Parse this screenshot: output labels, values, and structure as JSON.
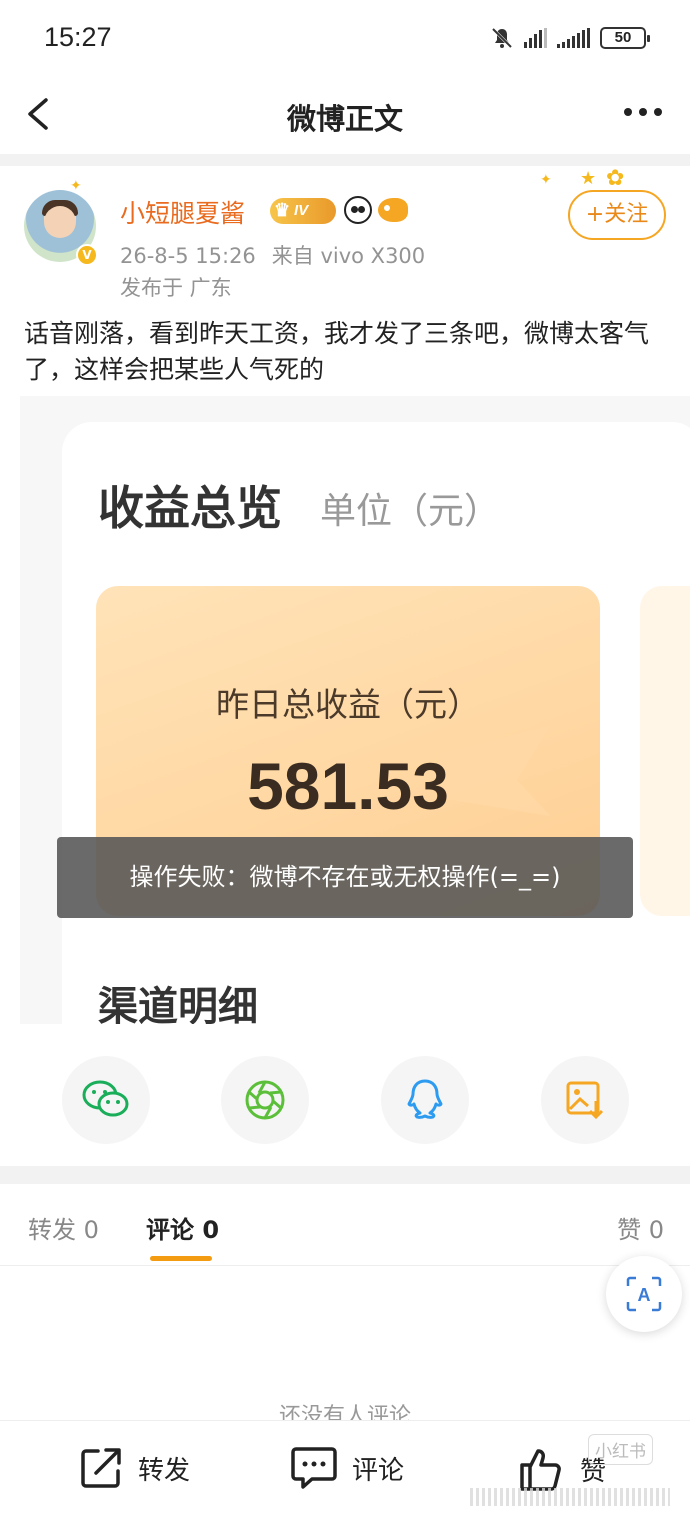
{
  "status_bar": {
    "time": "15:27",
    "battery": "50",
    "icons": [
      "mute-bell-icon",
      "signal-icon",
      "signal-icon",
      "battery-icon"
    ]
  },
  "nav": {
    "title": "微博正文",
    "back_icon": "chevron-left-icon",
    "more_icon": "more-dots-icon"
  },
  "post": {
    "user_name": "小短腿夏酱",
    "badge_level": "IV",
    "date": "26-8-5 15:26",
    "source": "来自 vivo X300",
    "location": "发布于 广东",
    "follow_label": "+关注",
    "text": "话音刚落，看到昨天工资，我才发了三条吧，微博太客气了，这样会把某些人气死的"
  },
  "image": {
    "title": "收益总览",
    "unit": "单位（元）",
    "earn_label": "昨日总收益（元）",
    "earn_value": "581.53",
    "section_title": "渠道明细"
  },
  "toast": {
    "message": "操作失败：微博不存在或无权操作(=_=)"
  },
  "share": {
    "items": [
      "wechat-icon",
      "moments-icon",
      "qq-icon",
      "save-image-icon"
    ]
  },
  "tabs": {
    "repost": "转发 0",
    "comment": "评论 0",
    "like": "赞 0"
  },
  "comments": {
    "empty_text": "还没有人评论"
  },
  "bottom_bar": {
    "repost": "转发",
    "comment": "评论",
    "like": "赞"
  },
  "watermark": "小红书",
  "colors": {
    "accent": "#f39c12",
    "username": "#e86b1f",
    "toast_bg": "#555555"
  }
}
